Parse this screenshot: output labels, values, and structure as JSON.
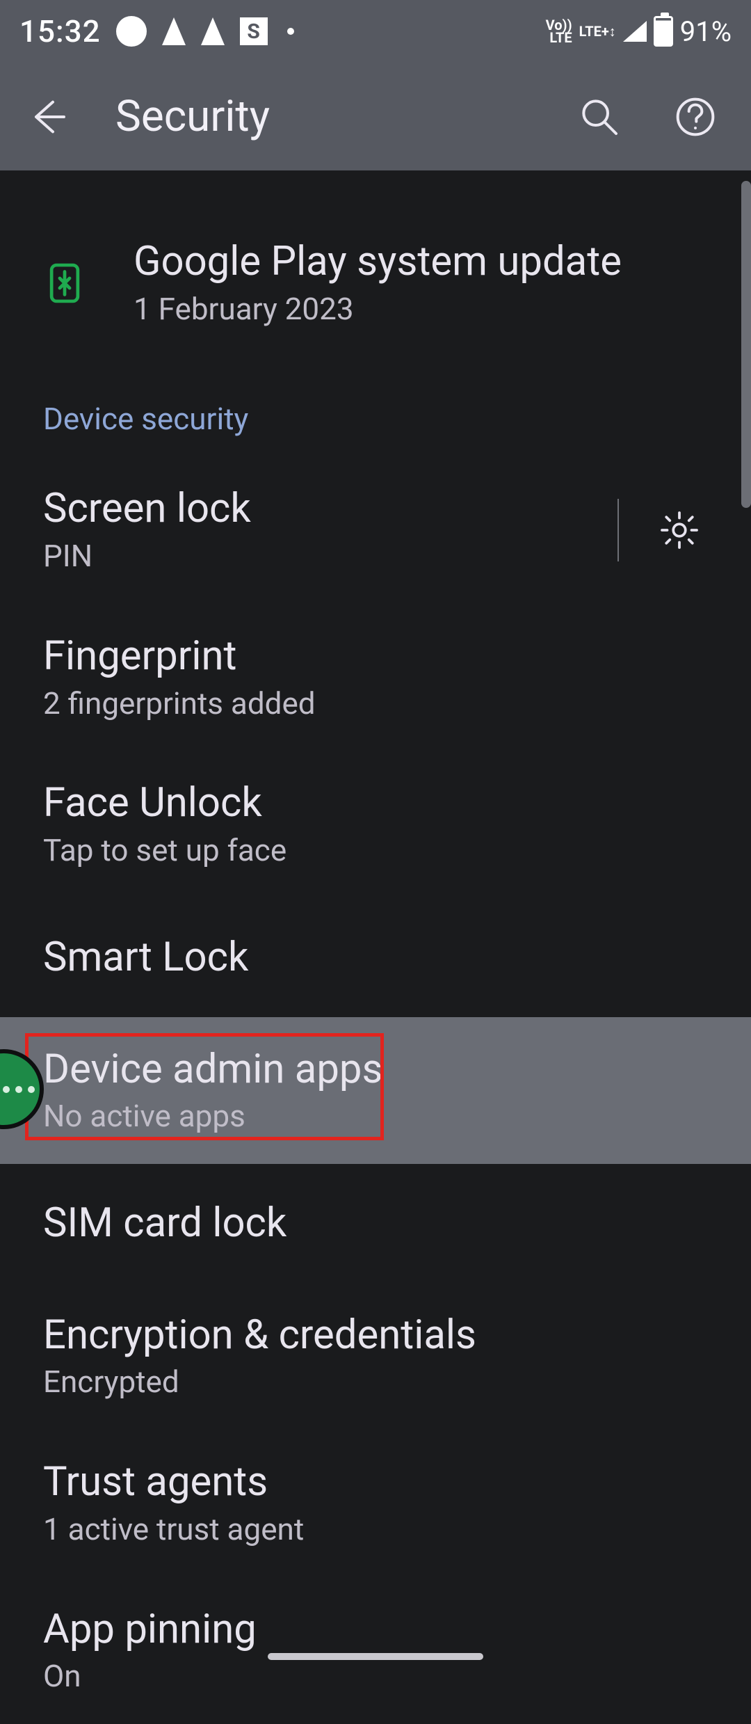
{
  "status": {
    "time": "15:32",
    "square_letter": "S",
    "volte": "Vo))\nLTE",
    "lte": "LTE+↕",
    "battery_pct": "91%"
  },
  "appbar": {
    "title": "Security"
  },
  "update": {
    "title": "Google Play system update",
    "sub": "1 February 2023"
  },
  "section1": "Device security",
  "items": {
    "screen_lock": {
      "title": "Screen lock",
      "sub": "PIN"
    },
    "fingerprint": {
      "title": "Fingerprint",
      "sub": "2 fingerprints added"
    },
    "face_unlock": {
      "title": "Face Unlock",
      "sub": "Tap to set up face"
    },
    "smart_lock": {
      "title": "Smart Lock"
    },
    "device_admin": {
      "title": "Device admin apps",
      "sub": "No active apps"
    },
    "sim_lock": {
      "title": "SIM card lock"
    },
    "enc_cred": {
      "title": "Encryption & credentials",
      "sub": "Encrypted"
    },
    "trust_agents": {
      "title": "Trust agents",
      "sub": "1 active trust agent"
    },
    "app_pinning": {
      "title": "App pinning",
      "sub": "On"
    }
  }
}
